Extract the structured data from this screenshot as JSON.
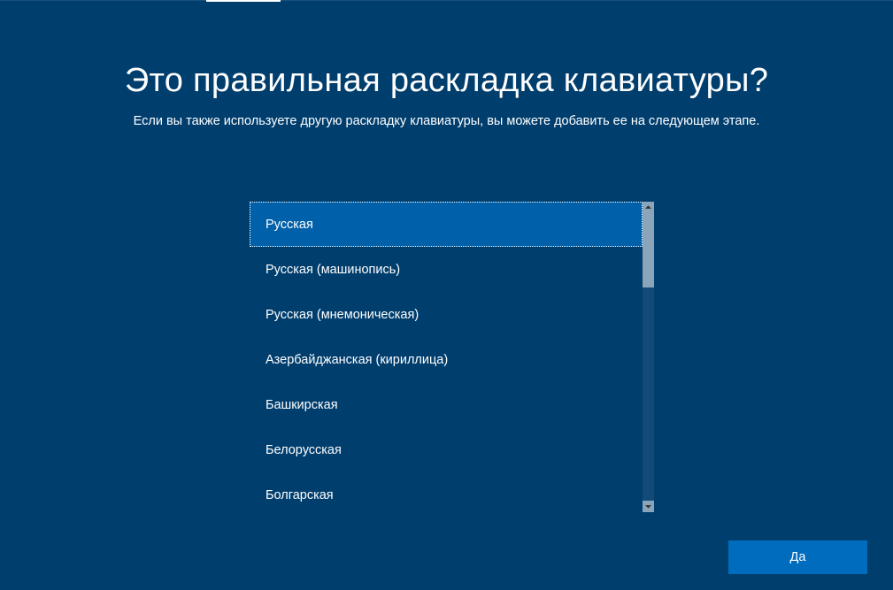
{
  "header": {
    "title": "Это правильная раскладка клавиатуры?",
    "subtitle": "Если вы также используете другую раскладку клавиатуры, вы можете добавить ее на следующем этапе."
  },
  "layouts": {
    "items": [
      "Русская",
      "Русская (машинопись)",
      "Русская (мнемоническая)",
      "Азербайджанская (кириллица)",
      "Башкирская",
      "Белорусская",
      "Болгарская"
    ],
    "selected_index": 0
  },
  "footer": {
    "confirm_label": "Да"
  }
}
